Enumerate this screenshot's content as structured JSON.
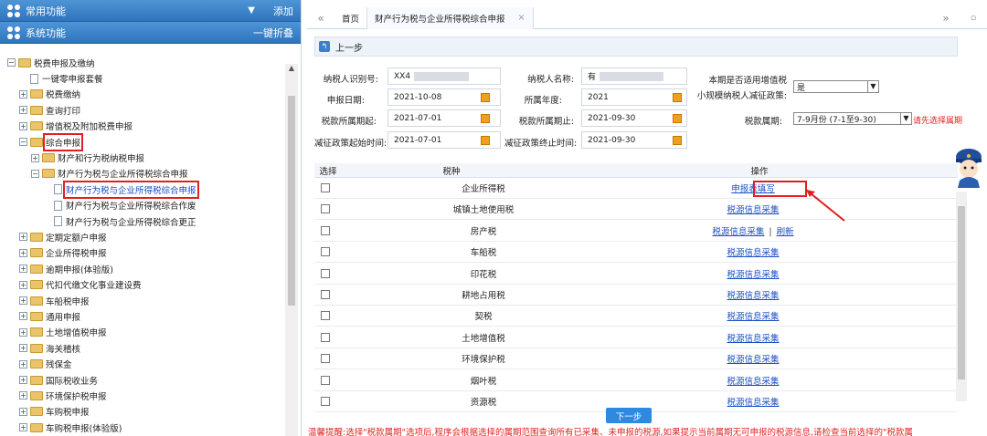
{
  "sidebar": {
    "common_label": "常用功能",
    "common_action": "添加",
    "system_label": "系统功能",
    "system_action": "一键折叠",
    "tree": [
      {
        "label": "税费申报及缴纳",
        "level": 0,
        "type": "folder",
        "exp": "−"
      },
      {
        "label": "一键零申报套餐",
        "level": 1,
        "type": "file"
      },
      {
        "label": "税费缴纳",
        "level": 1,
        "type": "folder",
        "exp": "+"
      },
      {
        "label": "查询打印",
        "level": 1,
        "type": "folder",
        "exp": "+"
      },
      {
        "label": "增值税及附加税费申报",
        "level": 1,
        "type": "folder",
        "exp": "+"
      },
      {
        "label": "综合申报",
        "level": 1,
        "type": "folder",
        "exp": "−",
        "highlight": true
      },
      {
        "label": "财产和行为税纳税申报",
        "level": 2,
        "type": "folder",
        "exp": "+"
      },
      {
        "label": "财产行为税与企业所得税综合申报",
        "level": 2,
        "type": "folder",
        "exp": "−"
      },
      {
        "label": "财产行为税与企业所得税综合申报",
        "level": 3,
        "type": "file",
        "highlight": true,
        "selected": true
      },
      {
        "label": "财产行为税与企业所得税综合作废",
        "level": 3,
        "type": "file"
      },
      {
        "label": "财产行为税与企业所得税综合更正",
        "level": 3,
        "type": "file"
      },
      {
        "label": "定期定额户申报",
        "level": 1,
        "type": "folder",
        "exp": "+"
      },
      {
        "label": "企业所得税申报",
        "level": 1,
        "type": "folder",
        "exp": "+"
      },
      {
        "label": "逾期申报(体验版)",
        "level": 1,
        "type": "folder",
        "exp": "+"
      },
      {
        "label": "代扣代缴文化事业建设费",
        "level": 1,
        "type": "folder",
        "exp": "+"
      },
      {
        "label": "车船税申报",
        "level": 1,
        "type": "folder",
        "exp": "+"
      },
      {
        "label": "通用申报",
        "level": 1,
        "type": "folder",
        "exp": "+"
      },
      {
        "label": "土地增值税申报",
        "level": 1,
        "type": "folder",
        "exp": "+"
      },
      {
        "label": "海关稽核",
        "level": 1,
        "type": "folder",
        "exp": "+"
      },
      {
        "label": "残保金",
        "level": 1,
        "type": "folder",
        "exp": "+"
      },
      {
        "label": "国际税收业务",
        "level": 1,
        "type": "folder",
        "exp": "+"
      },
      {
        "label": "环境保护税申报",
        "level": 1,
        "type": "folder",
        "exp": "+"
      },
      {
        "label": "车购税申报",
        "level": 1,
        "type": "folder",
        "exp": "+"
      },
      {
        "label": "车购税申报(体验版)",
        "level": 1,
        "type": "folder",
        "exp": "+"
      }
    ]
  },
  "tabs": {
    "prev": "«",
    "next": "»",
    "home": "首页",
    "active": "财产行为税与企业所得税综合申报",
    "close": "×"
  },
  "toolbar": {
    "back_label": "上一步"
  },
  "form": {
    "taxpayer_id_label": "纳税人识别号:",
    "taxpayer_id_value": "XX4",
    "taxpayer_name_label": "纳税人名称:",
    "taxpayer_name_value": "有",
    "vat_label_1": "本期是否适用增值税",
    "vat_label_2": "小规模纳税人减征政策:",
    "vat_value": "是",
    "declare_date_label": "申报日期:",
    "declare_date_value": "2021-10-08",
    "year_label": "所属年度:",
    "year_value": "2021",
    "period_start_label": "税款所属期起:",
    "period_start_value": "2021-07-01",
    "period_end_label": "税款所属期止:",
    "period_end_value": "2021-09-30",
    "period_label": "税款属期:",
    "period_value": "7-9月份 (7-1至9-30)",
    "period_hint": "请先选择属期",
    "reduce_start_label": "减征政策起始时间:",
    "reduce_start_value": "2021-07-01",
    "reduce_end_label": "减征政策终止时间:",
    "reduce_end_value": "2021-09-30"
  },
  "table": {
    "col_select": "选择",
    "col_tax": "税种",
    "col_action": "操作",
    "rows": [
      {
        "tax": "企业所得税",
        "link1": "申报表填写",
        "sep": "",
        "link2": ""
      },
      {
        "tax": "城镇土地使用税",
        "link1": "税源信息采集",
        "sep": "",
        "link2": ""
      },
      {
        "tax": "房产税",
        "link1": "税源信息采集",
        "sep": "|",
        "link2": "刷新"
      },
      {
        "tax": "车船税",
        "link1": "税源信息采集",
        "sep": "",
        "link2": ""
      },
      {
        "tax": "印花税",
        "link1": "税源信息采集",
        "sep": "",
        "link2": ""
      },
      {
        "tax": "耕地占用税",
        "link1": "税源信息采集",
        "sep": "",
        "link2": ""
      },
      {
        "tax": "契税",
        "link1": "税源信息采集",
        "sep": "",
        "link2": ""
      },
      {
        "tax": "土地增值税",
        "link1": "税源信息采集",
        "sep": "",
        "link2": ""
      },
      {
        "tax": "环境保护税",
        "link1": "税源信息采集",
        "sep": "",
        "link2": ""
      },
      {
        "tax": "烟叶税",
        "link1": "税源信息采集",
        "sep": "",
        "link2": ""
      },
      {
        "tax": "资源税",
        "link1": "税源信息采集",
        "sep": "",
        "link2": ""
      }
    ]
  },
  "next_label": "下一步",
  "notice": "温馨提醒:选择\"税款属期\"选项后,程序会根据选择的属期范围查询所有已采集、未申报的税源,如果提示当前属期无可申报的税源信息,请检查当前选择的\"税款属",
  "colors": {
    "accent": "#2f74bd",
    "warn": "#e02020",
    "link": "#1a4fc4"
  }
}
